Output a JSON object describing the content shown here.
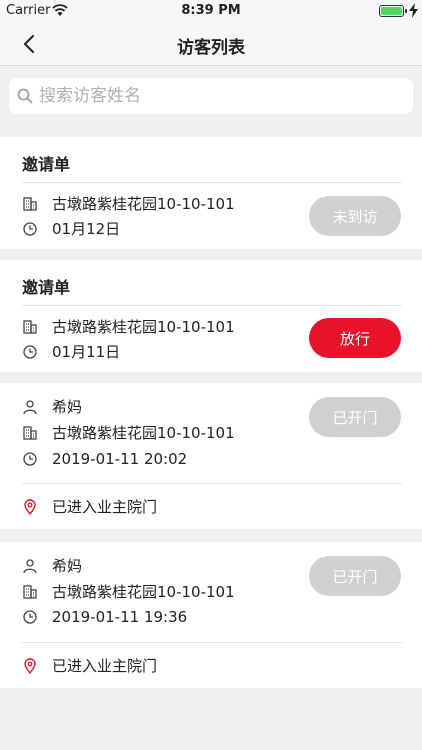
{
  "status": {
    "carrier": "Carrier",
    "time": "8:39 PM"
  },
  "nav": {
    "title": "访客列表"
  },
  "search": {
    "placeholder": "搜索访客姓名"
  },
  "colors": {
    "accent": "#e8132a",
    "disabled": "#d0d0d0"
  },
  "cards": [
    {
      "heading": "邀请单",
      "address": "古墩路紫桂花园10-10-101",
      "date": "01月12日",
      "button": "未到访"
    },
    {
      "heading": "邀请单",
      "address": "古墩路紫桂花园10-10-101",
      "date": "01月11日",
      "button": "放行"
    },
    {
      "name": "希妈",
      "address": "古墩路紫桂花园10-10-101",
      "datetime": "2019-01-11 20:02",
      "button": "已开门",
      "location": "已进入业主院门"
    },
    {
      "name": "希妈",
      "address": "古墩路紫桂花园10-10-101",
      "datetime": "2019-01-11 19:36",
      "button": "已开门",
      "location": "已进入业主院门"
    }
  ]
}
